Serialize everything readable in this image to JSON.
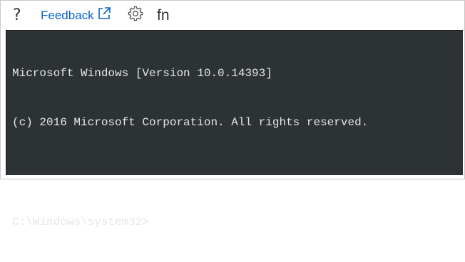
{
  "toolbar": {
    "help_label": "?",
    "feedback_label": "Feedback",
    "fn_label": "fn",
    "icons": {
      "external": "external-link-icon",
      "settings": "gear-icon"
    },
    "colors": {
      "link": "#0b63c4",
      "icon": "#555555"
    }
  },
  "terminal": {
    "lines": [
      "Microsoft Windows [Version 10.0.14393]",
      "(c) 2016 Microsoft Corporation. All rights reserved.",
      "",
      "C:\\Windows\\system32>"
    ],
    "background": "#2d3235",
    "foreground": "#e4e6e8"
  }
}
